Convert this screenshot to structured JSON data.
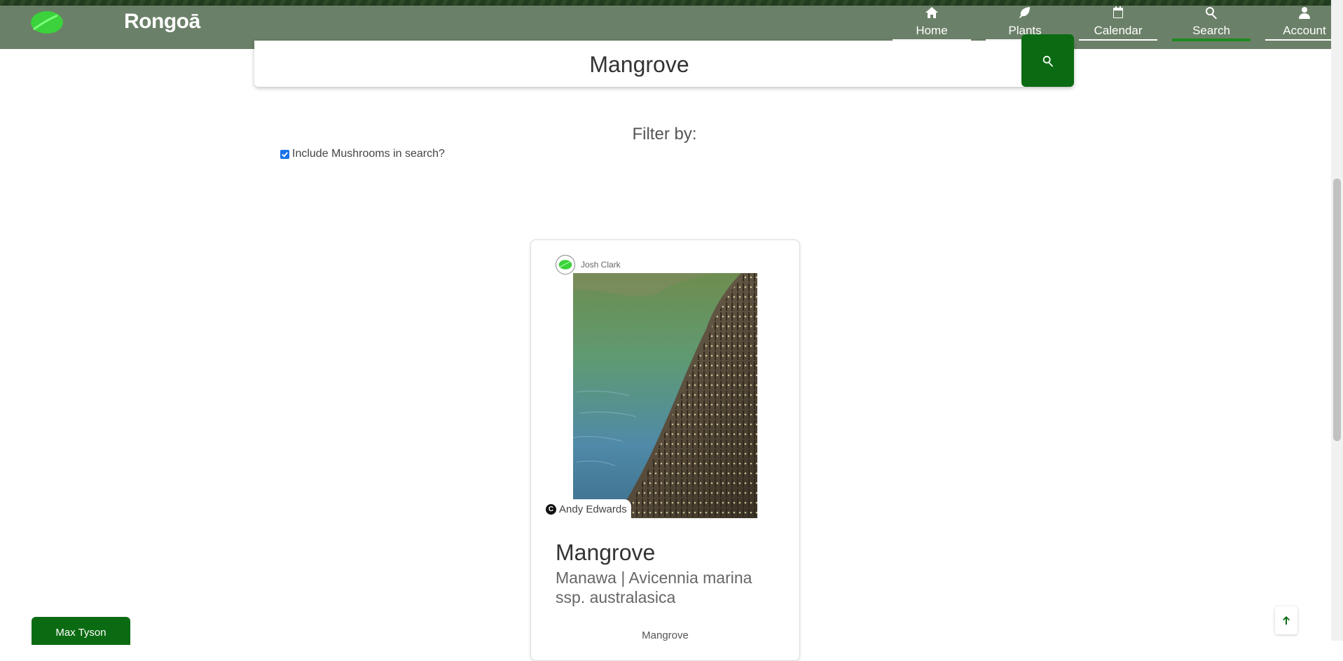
{
  "app": {
    "brand": "Rongoā"
  },
  "nav": {
    "items": [
      {
        "label": "Home",
        "icon": "home-icon"
      },
      {
        "label": "Plants",
        "icon": "leaf-icon"
      },
      {
        "label": "Calendar",
        "icon": "calendar-icon"
      },
      {
        "label": "Search",
        "icon": "search-icon",
        "active": true
      },
      {
        "label": "Account",
        "icon": "user-icon"
      }
    ]
  },
  "search": {
    "value": "Mangrove"
  },
  "filter": {
    "title": "Filter by:",
    "mushrooms_label": "Include Mushrooms in search?",
    "mushrooms_checked": true
  },
  "card": {
    "author": "Josh Clark",
    "image_credit": "Andy Edwards",
    "title": "Mangrove",
    "subtitle": "Manawa | Avicennia marina ssp. australasica",
    "tag": "Mangrove"
  },
  "user": {
    "name": "Max Tyson"
  },
  "colors": {
    "header": "#6b8068",
    "accent": "#0b6b12",
    "active_underline": "#1f8a1f"
  }
}
